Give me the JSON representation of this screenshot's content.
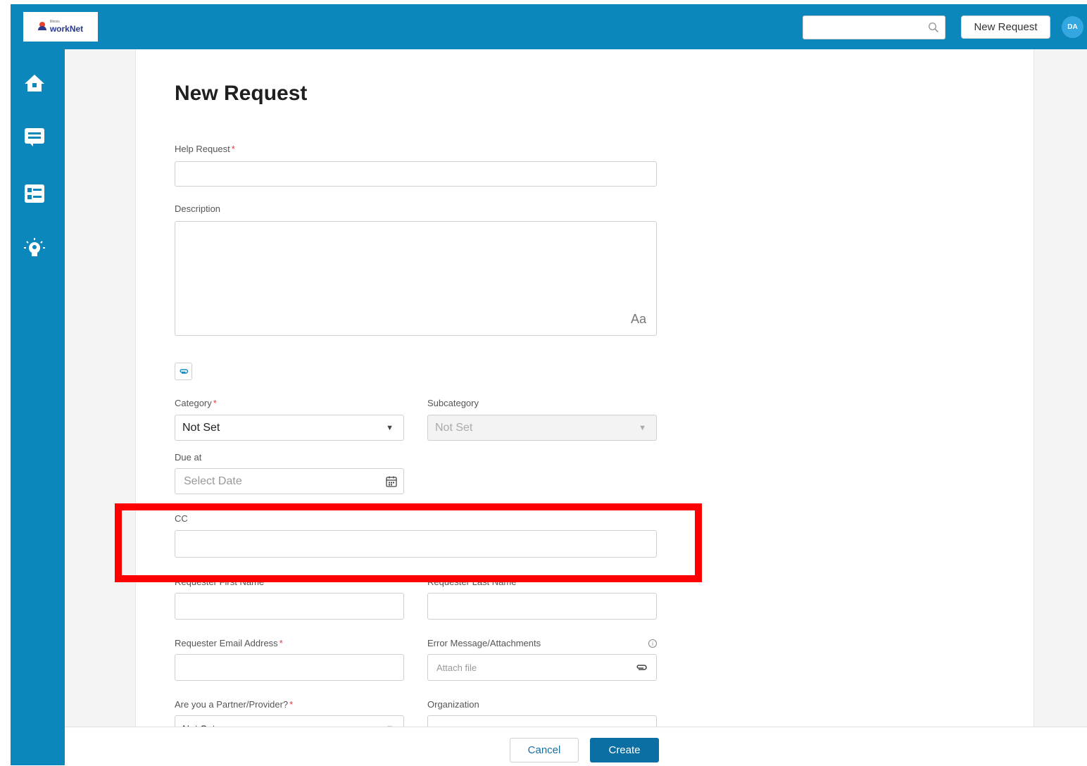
{
  "header": {
    "logo_text": "workNet",
    "logo_small_text": "Illinois",
    "search_placeholder": "",
    "new_request_label": "New Request",
    "avatar_initials": "DA"
  },
  "sidebar": {
    "items": [
      {
        "icon": "home-icon"
      },
      {
        "icon": "tickets-icon"
      },
      {
        "icon": "list-icon"
      },
      {
        "icon": "lightbulb-icon"
      }
    ]
  },
  "form": {
    "title": "New Request",
    "help_request_label": "Help Request",
    "description_label": "Description",
    "description_format_toggle": "Aa",
    "category_label": "Category",
    "category_value": "Not Set",
    "subcategory_label": "Subcategory",
    "subcategory_value": "Not Set",
    "due_at_label": "Due at",
    "due_at_placeholder": "Select Date",
    "cc_label": "CC",
    "first_name_label": "Requester First Name",
    "last_name_label": "Requester Last Name",
    "email_label": "Requester Email Address",
    "error_message_label": "Error Message/Attachments",
    "attach_file_placeholder": "Attach file",
    "partner_label": "Are you a Partner/Provider?",
    "partner_value": "Not Set",
    "organization_label": "Organization",
    "required_marker": "*"
  },
  "footer": {
    "cancel_label": "Cancel",
    "create_label": "Create"
  },
  "colors": {
    "brand": "#0b87bc",
    "primary_button": "#0b6fa4",
    "highlight": "#ff0000",
    "required": "#e03a3a"
  }
}
